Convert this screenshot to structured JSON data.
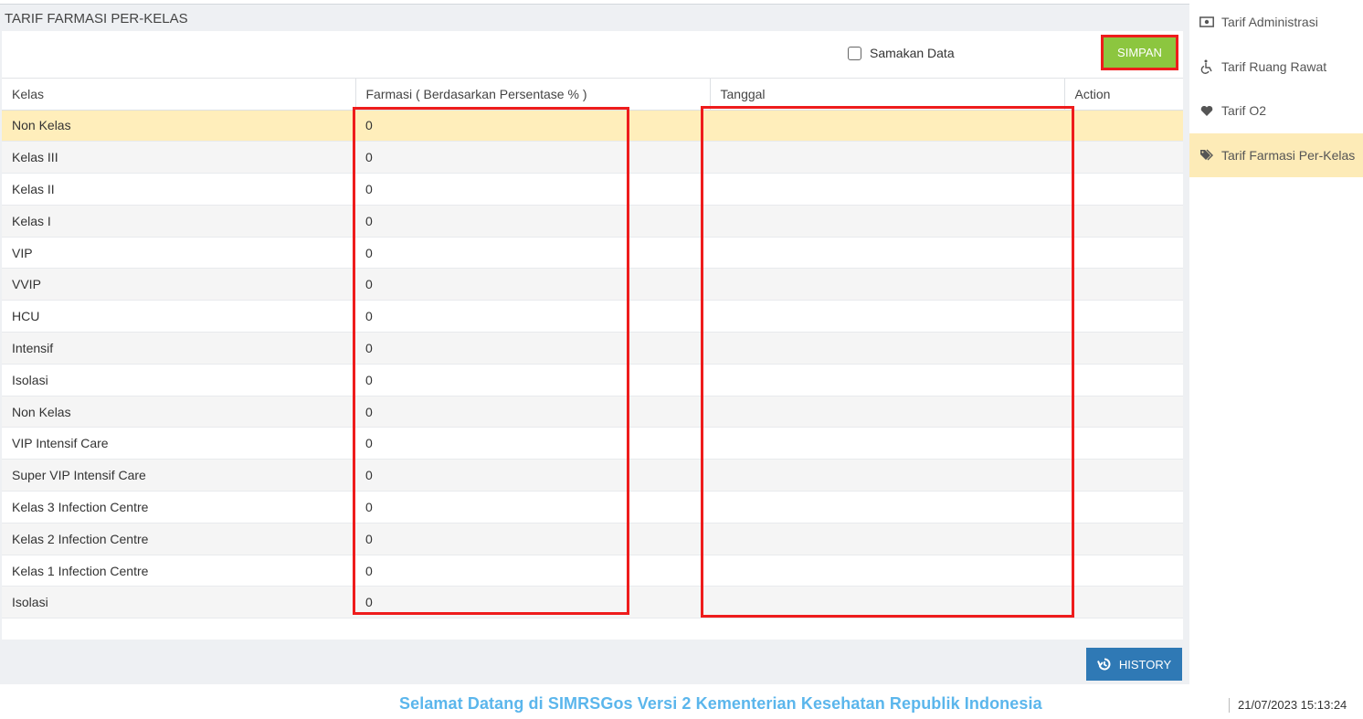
{
  "panel": {
    "title": "TARIF FARMASI PER-KELAS",
    "checkbox_label": "Samakan Data",
    "save_label": "SIMPAN",
    "history_label": "HISTORY"
  },
  "table": {
    "columns": [
      "Kelas",
      "Farmasi ( Berdasarkan Persentase % )",
      "Tanggal",
      "Action"
    ],
    "rows": [
      {
        "kelas": "Non Kelas",
        "farmasi": "0",
        "tanggal": "",
        "action": ""
      },
      {
        "kelas": "Kelas III",
        "farmasi": "0",
        "tanggal": "",
        "action": ""
      },
      {
        "kelas": "Kelas II",
        "farmasi": "0",
        "tanggal": "",
        "action": ""
      },
      {
        "kelas": "Kelas I",
        "farmasi": "0",
        "tanggal": "",
        "action": ""
      },
      {
        "kelas": "VIP",
        "farmasi": "0",
        "tanggal": "",
        "action": ""
      },
      {
        "kelas": "VVIP",
        "farmasi": "0",
        "tanggal": "",
        "action": ""
      },
      {
        "kelas": "HCU",
        "farmasi": "0",
        "tanggal": "",
        "action": ""
      },
      {
        "kelas": "Intensif",
        "farmasi": "0",
        "tanggal": "",
        "action": ""
      },
      {
        "kelas": "Isolasi",
        "farmasi": "0",
        "tanggal": "",
        "action": ""
      },
      {
        "kelas": "Non Kelas",
        "farmasi": "0",
        "tanggal": "",
        "action": ""
      },
      {
        "kelas": "VIP Intensif Care",
        "farmasi": "0",
        "tanggal": "",
        "action": ""
      },
      {
        "kelas": "Super VIP Intensif Care",
        "farmasi": "0",
        "tanggal": "",
        "action": ""
      },
      {
        "kelas": "Kelas 3 Infection Centre",
        "farmasi": "0",
        "tanggal": "",
        "action": ""
      },
      {
        "kelas": "Kelas 2 Infection Centre",
        "farmasi": "0",
        "tanggal": "",
        "action": ""
      },
      {
        "kelas": "Kelas 1 Infection Centre",
        "farmasi": "0",
        "tanggal": "",
        "action": ""
      },
      {
        "kelas": "Isolasi",
        "farmasi": "0",
        "tanggal": "",
        "action": ""
      }
    ]
  },
  "sidebar": {
    "items": [
      {
        "label": "Tarif Administrasi",
        "icon": "money-icon"
      },
      {
        "label": "Tarif Ruang Rawat",
        "icon": "wheelchair-icon"
      },
      {
        "label": "Tarif O2",
        "icon": "heart-icon"
      },
      {
        "label": "Tarif Farmasi Per-Kelas",
        "icon": "tags-icon",
        "active": true
      }
    ]
  },
  "footer": {
    "message": "Selamat Datang di SIMRSGos Versi 2 Kementerian Kesehatan Republik Indonesia",
    "clock": "21/07/2023 15:13:24"
  },
  "colors": {
    "save_button": "#8cc63f",
    "history_button": "#2f79b5",
    "highlight": "#ee1c1c",
    "selected_row": "#ffeebb",
    "footer_text": "#5bb6ec"
  }
}
